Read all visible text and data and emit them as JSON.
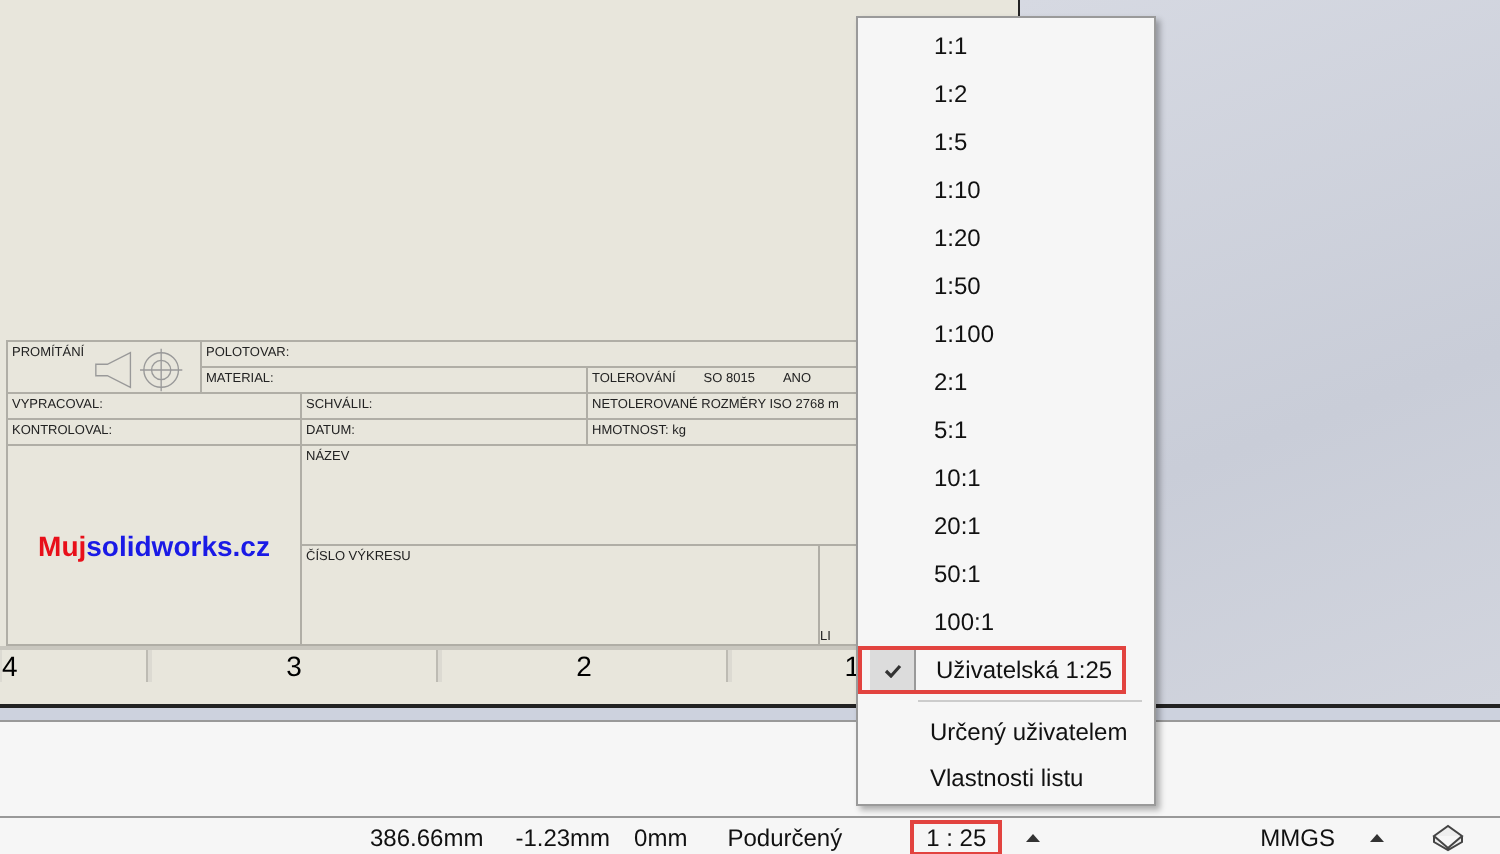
{
  "sheet": {
    "title_block": {
      "projection": "PROMÍTÁNÍ",
      "blank": "POLOTOVAR:",
      "material": "MATERIAL:",
      "tolerancing": [
        "TOLEROVÁNÍ",
        "SO 8015",
        "ANO"
      ],
      "drawn_by": "VYPRACOVAL:",
      "approved": "SCHVÁLIL:",
      "untoleranced": "NETOLEROVANÉ ROZMĚRY ISO 2768 m",
      "checked_by": "KONTROLOVAL:",
      "date": "DATUM:",
      "mass": "HMOTNOST:  kg",
      "logo": [
        {
          "text": "Muj",
          "color": "#e8101a"
        },
        {
          "text": "solidworks.cz",
          "color": "#1a1ae6"
        }
      ],
      "title": "NÁZEV",
      "drawing_number": "ČÍSLO VÝKRESU",
      "sheet": "LI"
    },
    "zones": [
      "4",
      "3",
      "2",
      "1"
    ]
  },
  "menu": {
    "items": [
      {
        "label": "1:1",
        "checked": false
      },
      {
        "label": "1:2",
        "checked": false
      },
      {
        "label": "1:5",
        "checked": false
      },
      {
        "label": "1:10",
        "checked": false
      },
      {
        "label": "1:20",
        "checked": false
      },
      {
        "label": "1:50",
        "checked": false
      },
      {
        "label": "1:100",
        "checked": false
      },
      {
        "label": "2:1",
        "checked": false
      },
      {
        "label": "5:1",
        "checked": false
      },
      {
        "label": "10:1",
        "checked": false
      },
      {
        "label": "20:1",
        "checked": false
      },
      {
        "label": "50:1",
        "checked": false
      },
      {
        "label": "100:1",
        "checked": false
      },
      {
        "label": "Uživatelská 1:25",
        "checked": true
      }
    ],
    "actions": [
      "Určený uživatelem",
      "Vlastnosti listu"
    ]
  },
  "status_bar": {
    "x": "386.66mm",
    "y": "-1.23mm",
    "z": "0mm",
    "state": "Podurčený",
    "scale": {
      "text": "1 : 25",
      "highlighted": true
    },
    "units": "MMGS"
  }
}
